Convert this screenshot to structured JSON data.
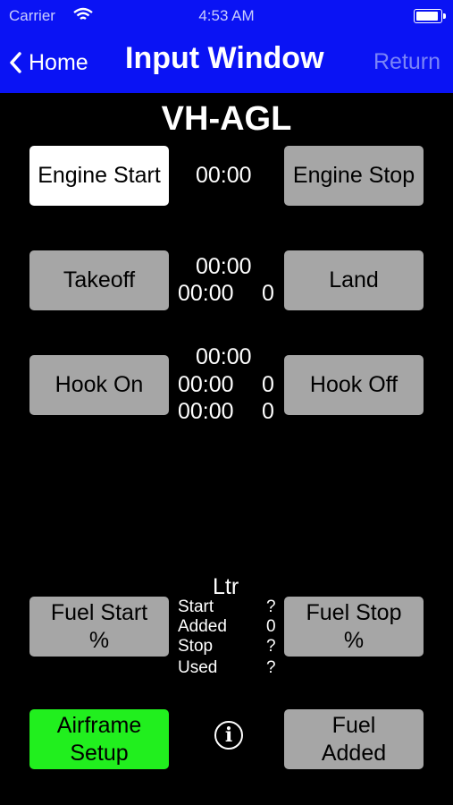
{
  "status": {
    "carrier": "Carrier",
    "time": "4:53 AM"
  },
  "nav": {
    "back_label": "Home",
    "title": "Input Window",
    "return_label": "Return"
  },
  "aircraft": "VH-AGL",
  "engine": {
    "start_label": "Engine Start",
    "stop_label": "Engine Stop",
    "time": "00:00"
  },
  "flight": {
    "takeoff_label": "Takeoff",
    "land_label": "Land",
    "time1": "00:00",
    "time2": "00:00",
    "count": "0"
  },
  "hook": {
    "on_label": "Hook On",
    "off_label": "Hook Off",
    "time1": "00:00",
    "time2": "00:00",
    "count2": "0",
    "time3": "00:00",
    "count3": "0"
  },
  "fuel": {
    "start_label_1": "Fuel Start",
    "start_label_2": "%",
    "stop_label_1": "Fuel Stop",
    "stop_label_2": "%",
    "unit": "Ltr",
    "rows": [
      {
        "label": "Start",
        "value": "?"
      },
      {
        "label": "Added",
        "value": "0"
      },
      {
        "label": "Stop",
        "value": "?"
      },
      {
        "label": "Used",
        "value": "?"
      }
    ],
    "added_label_1": "Fuel",
    "added_label_2": "Added"
  },
  "airframe": {
    "label_1": "Airframe",
    "label_2": "Setup"
  },
  "info_glyph": "i",
  "colors": {
    "nav_blue": "#0a13f4",
    "button_gray": "#a6a6a6",
    "button_green": "#21ef1e",
    "button_white": "#ffffff"
  }
}
